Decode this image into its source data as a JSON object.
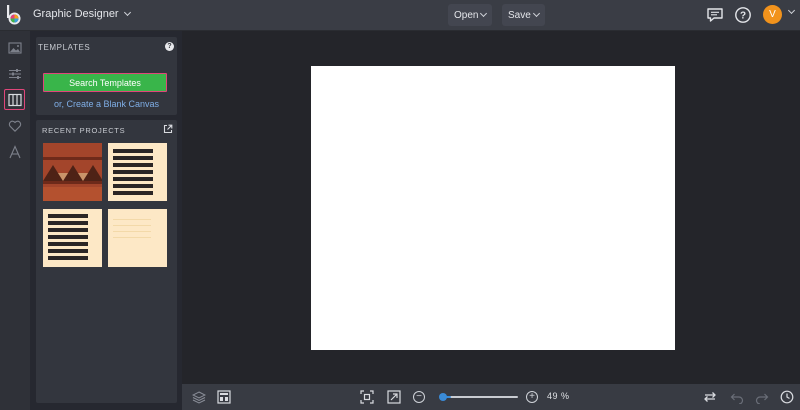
{
  "app": {
    "name": "Graphic Designer"
  },
  "toolbar": {
    "open_label": "Open",
    "save_label": "Save"
  },
  "user": {
    "avatar_initial": "V"
  },
  "rail": {
    "items": [
      "photo-icon",
      "sliders-icon",
      "templates-icon",
      "heart-icon",
      "text-icon"
    ],
    "active": "templates-icon"
  },
  "templates_panel": {
    "title": "TEMPLATES",
    "help": "?",
    "search_button": "Search Templates",
    "blank_canvas_link": "or, Create a Blank Canvas"
  },
  "recent_projects": {
    "title": "RECENT PROJECTS",
    "thumbnails": [
      {
        "style": "brown-pattern"
      },
      {
        "style": "cream-text-blocks"
      },
      {
        "style": "cream-text-blocks"
      },
      {
        "style": "cream-faint-text"
      }
    ]
  },
  "canvas": {
    "background": "#ffffff"
  },
  "zoom": {
    "percent": 49,
    "label": "49 %"
  },
  "colors": {
    "accent": "#3a8bd8",
    "search_button": "#39b54a",
    "highlight": "#e0467a",
    "avatar": "#f2931c"
  }
}
